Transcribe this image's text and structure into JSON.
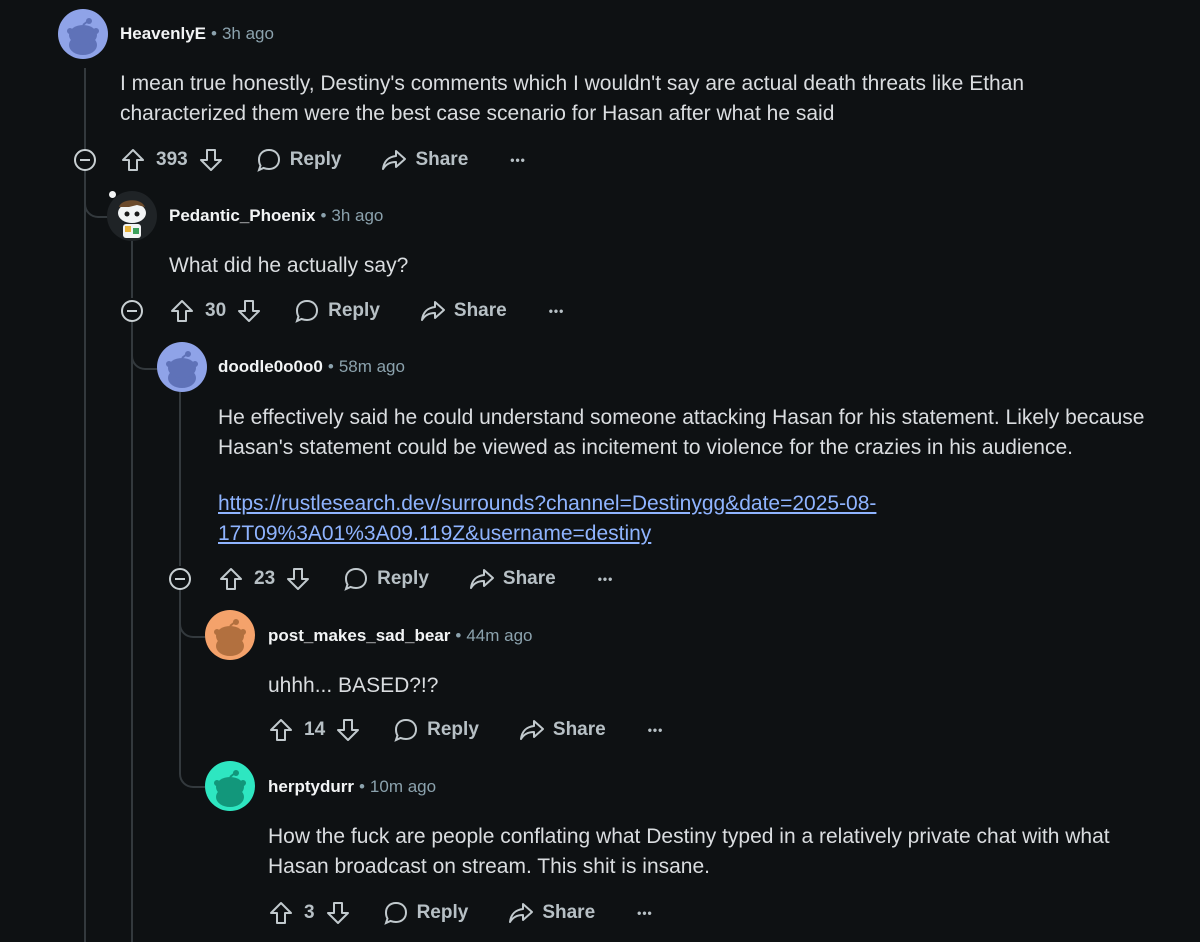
{
  "comments": [
    {
      "username": "HeavenlyE",
      "time": "3h ago",
      "body": [
        "I mean true honestly, Destiny's comments which I wouldn't say are actual death threats like Ethan",
        "characterized them were the best case scenario for Hasan after what he said"
      ],
      "votes": "393",
      "avatar_color": "#8fa3e8"
    },
    {
      "username": "Pedantic_Phoenix",
      "time": "3h ago",
      "body": [
        "What did he actually say?"
      ],
      "votes": "30",
      "avatar_color": "#1f2326"
    },
    {
      "username": "doodle0o0o0",
      "time": "58m ago",
      "body": [
        "He effectively said he could understand someone attacking Hasan for his statement. Likely because",
        "Hasan's statement could be viewed as incitement to violence for the crazies in his audience."
      ],
      "link_lines": [
        "https://rustlesearch.dev/surrounds?channel=Destinygg&date=2025-08-",
        "17T09%3A01%3A09.119Z&username=destiny"
      ],
      "votes": "23",
      "avatar_color": "#8fa3e8"
    },
    {
      "username": "post_makes_sad_bear",
      "time": "44m ago",
      "body": [
        "uhhh... BASED?!?"
      ],
      "votes": "14",
      "avatar_color": "#f4a26b"
    },
    {
      "username": "herptydurr",
      "time": "10m ago",
      "body": [
        "How the fuck are people conflating what Destiny typed in a relatively private chat with what",
        "Hasan broadcast on stream. This shit is insane."
      ],
      "votes": "3",
      "avatar_color": "#2ee6c1"
    }
  ],
  "actions": {
    "reply": "Reply",
    "share": "Share",
    "more": "•••",
    "separator": "•"
  },
  "icons": {
    "upvote": "upvote-arrow-icon",
    "downvote": "downvote-arrow-icon",
    "reply": "speech-bubble-icon",
    "share": "share-arrow-icon",
    "collapse": "collapse-minus-icon"
  }
}
